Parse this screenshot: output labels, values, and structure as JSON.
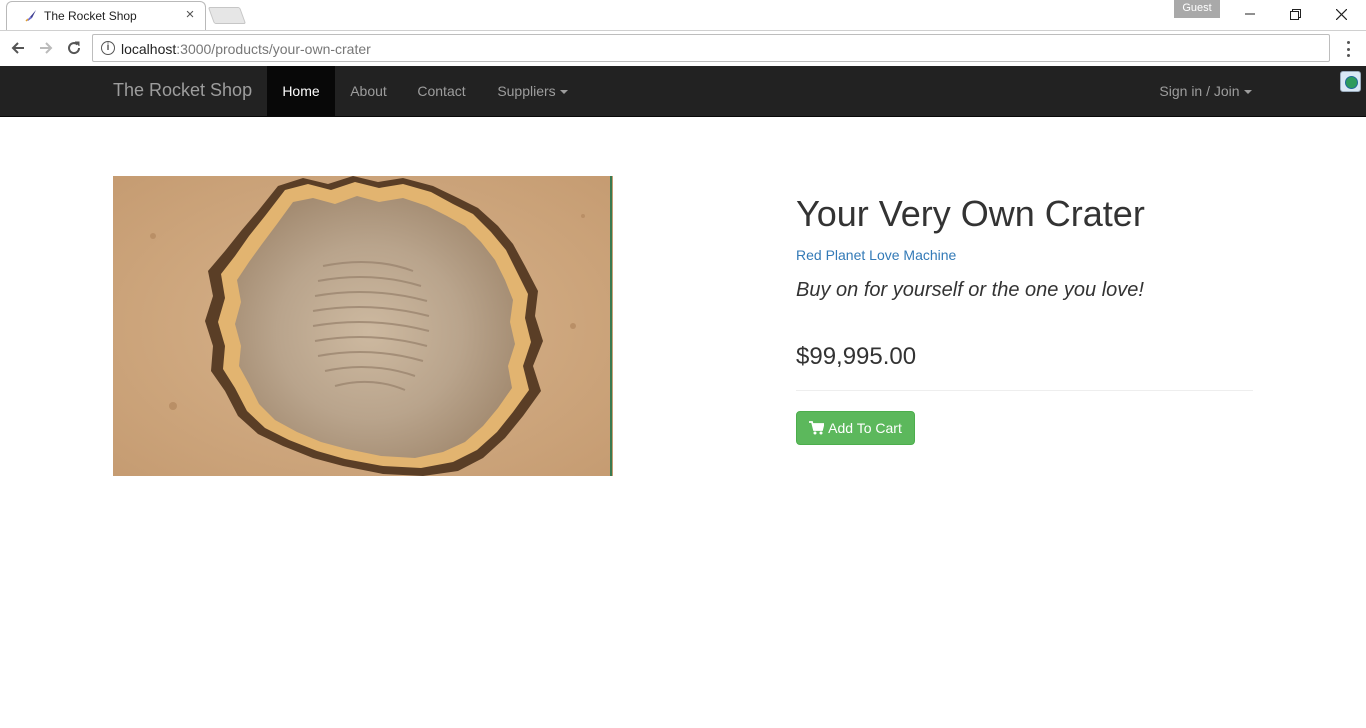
{
  "browser": {
    "tab_title": "The Rocket Shop",
    "tab_close": "×",
    "profile_label": "Guest",
    "url_host": "localhost",
    "url_path": ":3000/products/your-own-crater"
  },
  "navbar": {
    "brand": "The Rocket Shop",
    "items": [
      {
        "label": "Home",
        "active": true
      },
      {
        "label": "About"
      },
      {
        "label": "Contact"
      },
      {
        "label": "Suppliers"
      }
    ],
    "signin": "Sign in / Join"
  },
  "product": {
    "title": "Your Very Own Crater",
    "supplier": "Red Planet Love Machine",
    "tagline": "Buy on for yourself or the one you love!",
    "price": "$99,995.00",
    "add_to_cart": "Add To Cart"
  },
  "colors": {
    "navbar_bg": "#222222",
    "link": "#337ab7",
    "success_button": "#5cb85c"
  },
  "icons": [
    "rocket-icon",
    "close-icon",
    "back-icon",
    "forward-icon",
    "reload-icon",
    "info-icon",
    "menu-icon",
    "caret-down-icon",
    "cart-icon",
    "extension-icon"
  ]
}
